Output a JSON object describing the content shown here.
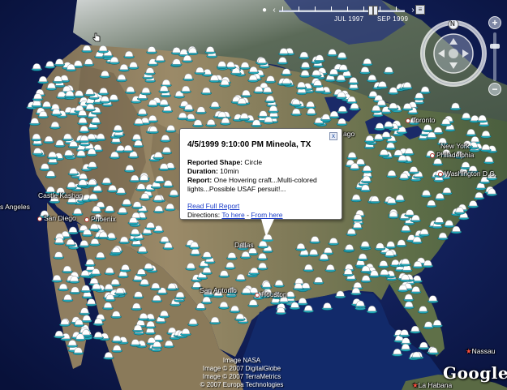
{
  "timeline": {
    "start_label": "JUL 1997",
    "end_label": "SEP 1999"
  },
  "navigation": {
    "compass_north": "N",
    "zoom_in": "+",
    "zoom_out": "−"
  },
  "cities": [
    {
      "name": "Castle Kashan",
      "marker": "none"
    },
    {
      "name": "s Angeles",
      "marker": "none"
    },
    {
      "name": "San Diego",
      "marker": "dot"
    },
    {
      "name": "Phoenix",
      "marker": "dot"
    },
    {
      "name": "Dallas",
      "marker": "dot"
    },
    {
      "name": "San Antonio",
      "marker": "dot"
    },
    {
      "name": "Houston",
      "marker": "dot"
    },
    {
      "name": "Toronto",
      "marker": "dot"
    },
    {
      "name": "New York",
      "marker": "none"
    },
    {
      "name": "Philadelphia",
      "marker": "dot"
    },
    {
      "name": "Washington D.C.",
      "marker": "dot"
    },
    {
      "name": "Nassau",
      "marker": "star"
    },
    {
      "name": "La Habana",
      "marker": "star"
    },
    {
      "name": "ago",
      "marker": "none"
    }
  ],
  "popup": {
    "title": "4/5/1999 9:10:00 PM Mineola, TX",
    "shape_label": "Reported Shape:",
    "shape_value": "Circle",
    "duration_label": "Duration:",
    "duration_value": "10min",
    "report_label": "Report:",
    "report_value": "One Hovering craft...Multi-colored lights...Possible USAF persuit!...",
    "read_full_link": "Read Full Report",
    "directions_label": "Directions:",
    "to_here_link": "To here",
    "separator": "-",
    "from_here_link": "From here",
    "close_glyph": "x"
  },
  "credits": [
    "Image NASA",
    "Image © 2007 DigitalGlobe",
    "Image © 2007 TerraMetrics",
    "© 2007 Europa Technologies"
  ],
  "logo": "Google",
  "colors": {
    "ocean": "#0d1c52",
    "land_west": "#8a7a5c",
    "land_east": "#6f7a52",
    "marker_cup": "#ffffff",
    "marker_base": "#1fa7b8",
    "link": "#1a3cc8"
  }
}
